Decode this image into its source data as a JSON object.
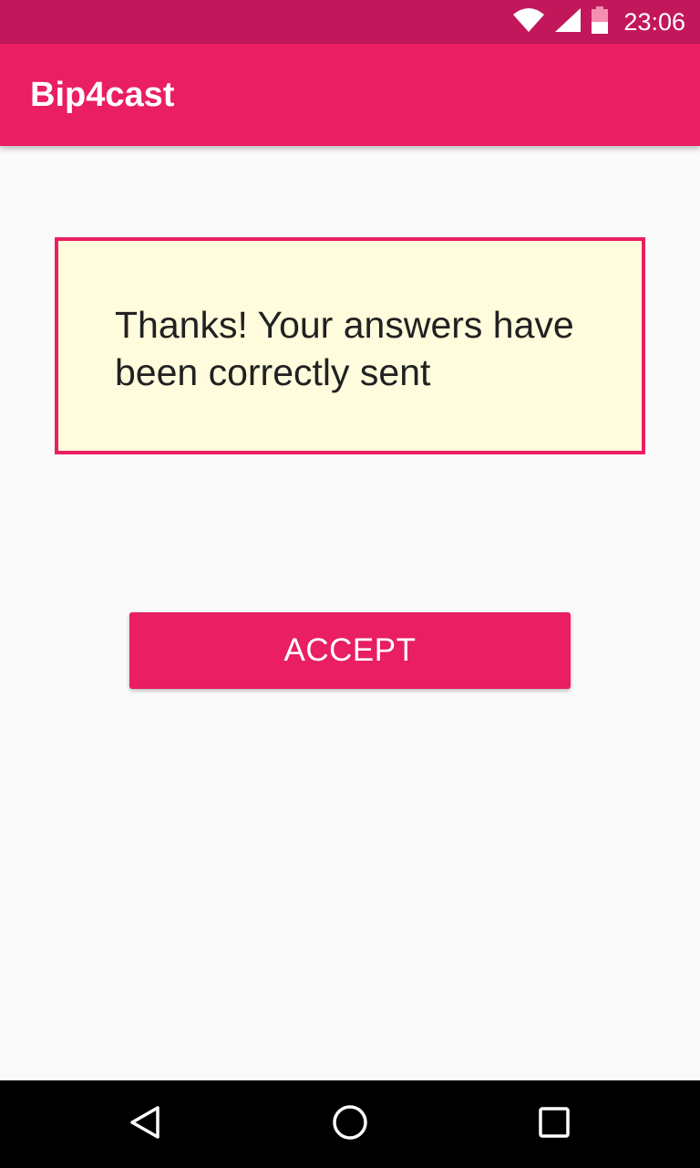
{
  "status_bar": {
    "time": "23:06",
    "icons": [
      "wifi-icon",
      "cellular-signal-icon",
      "battery-icon"
    ],
    "color": "#c2185b"
  },
  "app_bar": {
    "title": "Bip4cast",
    "color": "#e91e63"
  },
  "message": {
    "text": "Thanks! Your answers have been correctly sent",
    "border_color": "#e91e63",
    "background_color": "#fefcdc"
  },
  "accept_button": {
    "label": "ACCEPT",
    "color": "#e91e63"
  },
  "nav_bar": {
    "icons": [
      "back-icon",
      "home-icon",
      "recents-icon"
    ]
  }
}
